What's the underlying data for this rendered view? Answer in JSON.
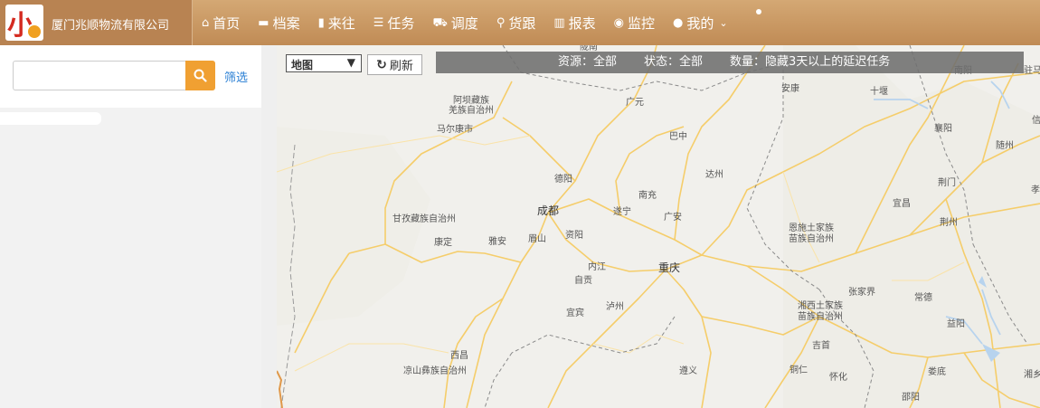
{
  "header": {
    "company_name": "厦门兆顺物流有限公司",
    "logo_mark": "小",
    "nav": [
      {
        "label": "首页",
        "icon": "home-icon",
        "glyph": "⌂"
      },
      {
        "label": "档案",
        "icon": "archive-icon",
        "glyph": "▬"
      },
      {
        "label": "来往",
        "icon": "book-icon",
        "glyph": "▮"
      },
      {
        "label": "任务",
        "icon": "list-icon",
        "glyph": "☰"
      },
      {
        "label": "调度",
        "icon": "truck-icon",
        "glyph": "⛟"
      },
      {
        "label": "货跟",
        "icon": "location-pin-icon",
        "glyph": "⚲"
      },
      {
        "label": "报表",
        "icon": "bar-chart-icon",
        "glyph": "▥"
      },
      {
        "label": "监控",
        "icon": "eye-icon",
        "glyph": "◉"
      },
      {
        "label": "我的",
        "icon": "user-icon",
        "glyph": "●"
      }
    ],
    "colors": {
      "bar": "#c59060",
      "brand_bg": "#b88352"
    }
  },
  "sidebar": {
    "search_value": "",
    "search_placeholder": "",
    "filter_label": "筛选",
    "search_button_color": "#f0a032"
  },
  "map": {
    "type_select": "地图",
    "refresh_label": "刷新",
    "info": {
      "resource": "资源：全部",
      "status": "状态：全部",
      "count": "数量：隐藏3天以上的延迟任务"
    },
    "labels": {
      "gs_top": "陇南",
      "aba1": "阿坝藏族",
      "aba2": "羌族自治州",
      "maerkang": "马尔康市",
      "guangyuan": "广元",
      "ankang": "安康",
      "shiyan": "十堰",
      "nanyang": "南阳",
      "zhuma": "驻马",
      "bazhong": "巴中",
      "xiangyang": "襄阳",
      "xin": "信",
      "suizhou": "随州",
      "dazhou": "达州",
      "deyang": "德阳",
      "jingmen": "荆门",
      "xiaogan": "孝感",
      "nanchong": "南充",
      "yichang": "宜昌",
      "chengdu": "成都",
      "suining": "遂宁",
      "guangan": "广安",
      "ganzi": "甘孜藏族自治州",
      "jingzhou": "荆州",
      "enshi1": "恩施土家族",
      "enshi2": "苗族自治州",
      "kangding": "康定",
      "yaan": "雅安",
      "meishan": "眉山",
      "ziyang": "资阳",
      "neijiang": "内江",
      "chongqing": "重庆",
      "zigong": "自贡",
      "zhangjiajie": "张家界",
      "changde": "常德",
      "luzhou": "泸州",
      "xiangxi1": "湘西土家族",
      "xiangxi2": "苗族自治州",
      "yibin": "宜宾",
      "yiyang": "益阳",
      "jishou": "吉首",
      "xichang": "西昌",
      "liangshan": "凉山彝族自治州",
      "zunyi": "遵义",
      "tongren": "铜仁",
      "huaihua": "怀化",
      "loudi": "娄底",
      "xiangtan": "湘乡",
      "shaoyang": "邵阳"
    }
  }
}
